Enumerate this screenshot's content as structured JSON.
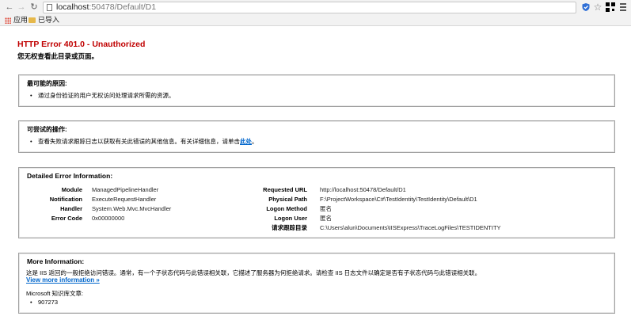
{
  "browser": {
    "url_host": "localhost",
    "url_path": ":50478/Default/D1",
    "bookmarks": [
      "应用",
      "已导入"
    ]
  },
  "page": {
    "title": "HTTP Error 401.0 - Unauthorized",
    "subtitle": "您无权查看此目录或页面。",
    "causes": {
      "heading": "最可能的原因:",
      "items": [
        "通过身份验证的用户无权访问处理请求所需的资源。"
      ]
    },
    "actions": {
      "heading": "可尝试的操作:",
      "item_text": "查看失败请求跟踪日志以获取有关此错误的其他信息。有关详细信息，请单击",
      "item_link": "此处",
      "item_end": "。"
    },
    "details": {
      "heading": "Detailed Error Information:",
      "left": [
        {
          "label": "Module",
          "value": "ManagedPipelineHandler"
        },
        {
          "label": "Notification",
          "value": "ExecuteRequestHandler"
        },
        {
          "label": "Handler",
          "value": "System.Web.Mvc.MvcHandler"
        },
        {
          "label": "Error Code",
          "value": "0x00000000"
        }
      ],
      "right": [
        {
          "label": "Requested URL",
          "value": "http://localhost:50478/Default/D1"
        },
        {
          "label": "Physical Path",
          "value": "F:\\ProjectWorkspace\\C#\\TestIdentity\\TestIdentity\\Default\\D1"
        },
        {
          "label": "Logon Method",
          "value": "匿名"
        },
        {
          "label": "Logon User",
          "value": "匿名"
        },
        {
          "label": "请求跟踪目录",
          "value": "C:\\Users\\alun\\Documents\\IISExpress\\TraceLogFiles\\TESTIDENTITY"
        }
      ]
    },
    "more": {
      "heading": "More Information:",
      "text": "这是 IIS 返回的一般拒绝访问错误。通常，有一个子状态代码与此错误相关联，它描述了服务器为何拒绝请求。请检查 IIS 日志文件以确定是否有子状态代码与此错误相关联。",
      "link": "View more information »",
      "ms_label": "Microsoft 知识库文章:",
      "kb": [
        "907273"
      ]
    }
  }
}
